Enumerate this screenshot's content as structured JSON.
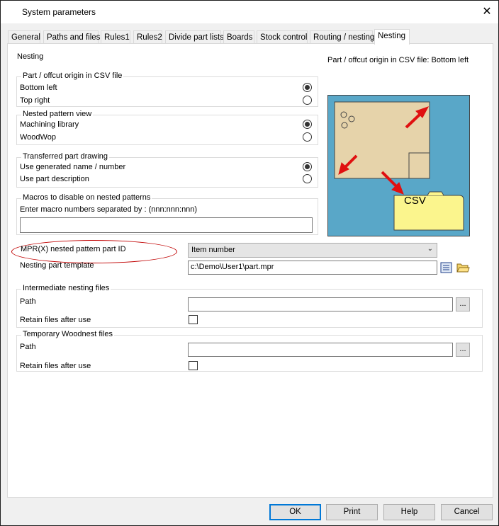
{
  "window": {
    "title": "System parameters",
    "close_glyph": "✕"
  },
  "tabs": [
    {
      "label": "General"
    },
    {
      "label": "Paths and files"
    },
    {
      "label": "Rules1"
    },
    {
      "label": "Rules2"
    },
    {
      "label": "Divide part lists"
    },
    {
      "label": "Boards"
    },
    {
      "label": "Stock control"
    },
    {
      "label": "Routing / nesting"
    },
    {
      "label": "Nesting",
      "active": true
    }
  ],
  "panel": {
    "section_title": "Nesting",
    "diagram_caption": "Part / offcut origin in CSV file: Bottom left",
    "diagram_csv_label": "CSV",
    "origin_group": {
      "title": "Part / offcut origin in CSV file",
      "options": [
        {
          "label": "Bottom left",
          "selected": true
        },
        {
          "label": "Top right",
          "selected": false
        }
      ]
    },
    "view_group": {
      "title": "Nested pattern view",
      "options": [
        {
          "label": "Machining library",
          "selected": true
        },
        {
          "label": "WoodWop",
          "selected": false
        }
      ]
    },
    "drawing_group": {
      "title": "Transferred part drawing",
      "options": [
        {
          "label": "Use generated name / number",
          "selected": true
        },
        {
          "label": "Use part description",
          "selected": false
        }
      ]
    },
    "macros_group": {
      "title": "Macros to disable on nested patterns",
      "instruction": "Enter macro numbers separated by : (nnn:nnn:nnn)",
      "value": ""
    },
    "part_id": {
      "label": "MPR(X) nested pattern part ID",
      "value": "Item number"
    },
    "template": {
      "label": "Nesting part template",
      "value": "c:\\Demo\\User1\\part.mpr"
    },
    "intermediate_group": {
      "title": "Intermediate nesting files",
      "path_label": "Path",
      "path_value": "",
      "browse_label": "...",
      "retain_label": "Retain files after use",
      "retain_checked": false
    },
    "woodnest_group": {
      "title": "Temporary Woodnest files",
      "path_label": "Path",
      "path_value": "",
      "browse_label": "...",
      "retain_label": "Retain files after use",
      "retain_checked": false
    }
  },
  "buttons": {
    "ok": "OK",
    "print": "Print",
    "help": "Help",
    "cancel": "Cancel"
  },
  "colors": {
    "accent": "#0078d7",
    "highlight_ellipse": "#c00000",
    "diagram_bg": "#59a7c8",
    "part": "#e6d3aa",
    "csv_folder": "#fbf58d",
    "arrow": "#e01010"
  }
}
